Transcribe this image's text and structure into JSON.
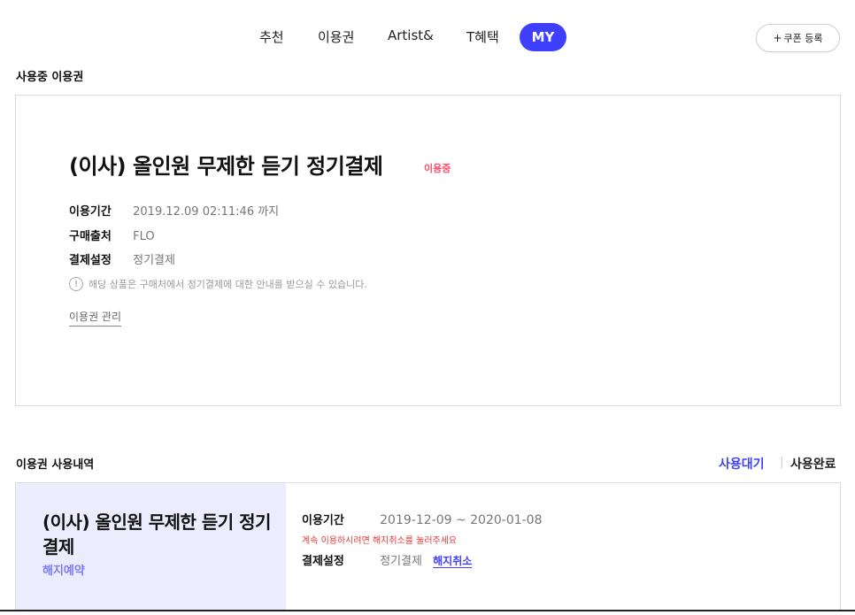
{
  "nav": {
    "items": [
      "추천",
      "이용권",
      "Artist&",
      "T혜택"
    ],
    "active": "MY",
    "coupon_plus": "+",
    "coupon_label": "쿠폰 등록"
  },
  "current": {
    "section_title": "사용중 이용권",
    "plan_title": "(이사) 올인원 무제한 듣기 정기결제",
    "status": "이용중",
    "period_label": "이용기간",
    "period_value": "2019.12.09 02:11:46 까지",
    "purchase_label": "구매출처",
    "purchase_value": "FLO",
    "payment_label": "결제설정",
    "payment_value": "정기결제",
    "notice_icon": "!",
    "notice": "해당 상품은 구매처에서 정기결제에 대한 안내를 받으실 수 있습니다.",
    "manage_link": "이용권 관리"
  },
  "history": {
    "section_title": "이용권 사용내역",
    "tab_active": "사용대기",
    "tab_separator": "|",
    "tab_inactive": "사용완료",
    "plan_title": "(이사) 올인원 무제한 듣기 정기결제",
    "status": "해지예약",
    "period_label": "이용기간",
    "period_value": "2019-12-09 ~ 2020-01-08",
    "warning": "계속 이용하시려면 해지취소를 눌러주세요",
    "payment_label": "결제설정",
    "payment_value": "정기결제",
    "cancel_link": "해지취소"
  },
  "colors": {
    "accent": "#3f3fff",
    "status_active": "#ff4c6a",
    "warning": "#e53935",
    "history_bg": "#ececff"
  }
}
